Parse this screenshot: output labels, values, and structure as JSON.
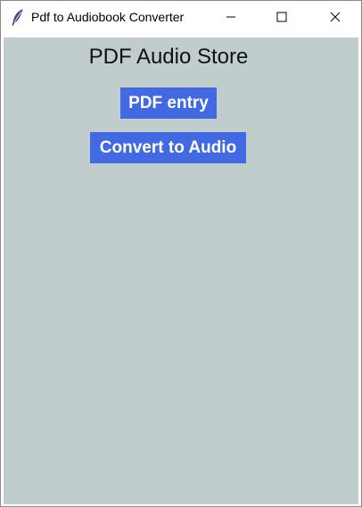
{
  "window": {
    "title": "Pdf to Audiobook Converter",
    "icon": "feather-icon"
  },
  "titlebar_controls": {
    "minimize": "minimize-icon",
    "maximize": "maximize-icon",
    "close": "close-icon"
  },
  "main": {
    "heading": "PDF Audio Store",
    "pdf_entry_label": "PDF entry",
    "convert_label": "Convert to Audio"
  },
  "colors": {
    "background": "#c1cdcd",
    "button": "#4169e1",
    "button_text": "#ffffff"
  }
}
